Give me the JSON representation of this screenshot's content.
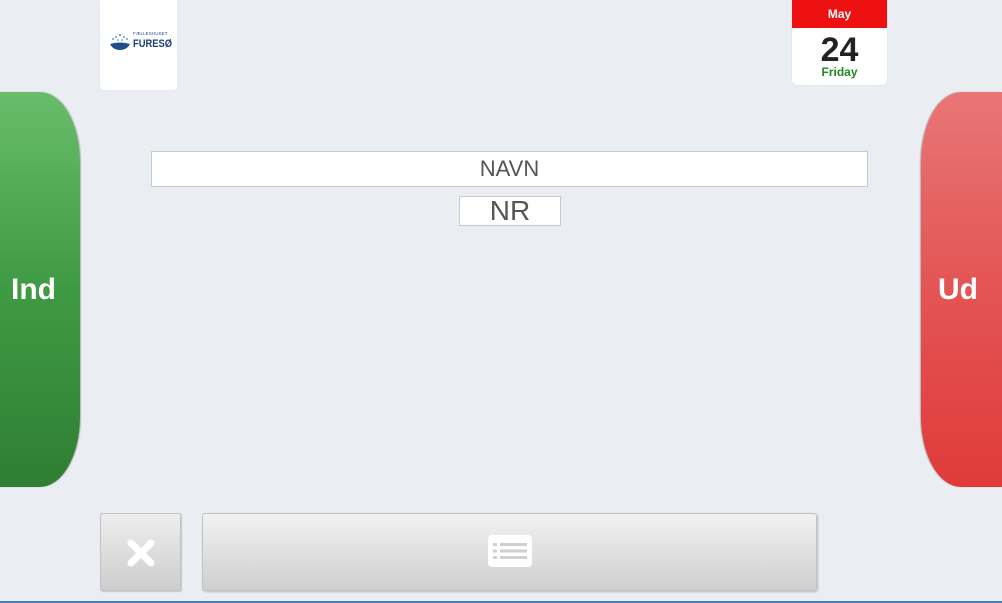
{
  "logo": {
    "small_text": "FÆLLESHUSET",
    "main_text": "FURESØ"
  },
  "calendar": {
    "month": "May",
    "day": "24",
    "weekday": "Friday"
  },
  "buttons": {
    "in_label": "Ind",
    "out_label": "Ud",
    "cancel_icon": "close-icon",
    "list_icon": "list-icon"
  },
  "fields": {
    "name": "NAVN",
    "number": "NR"
  },
  "colors": {
    "in_green": "#3f9a44",
    "out_red": "#e45454",
    "calendar_red": "#ee1111",
    "weekday_green": "#1f8a1f"
  }
}
